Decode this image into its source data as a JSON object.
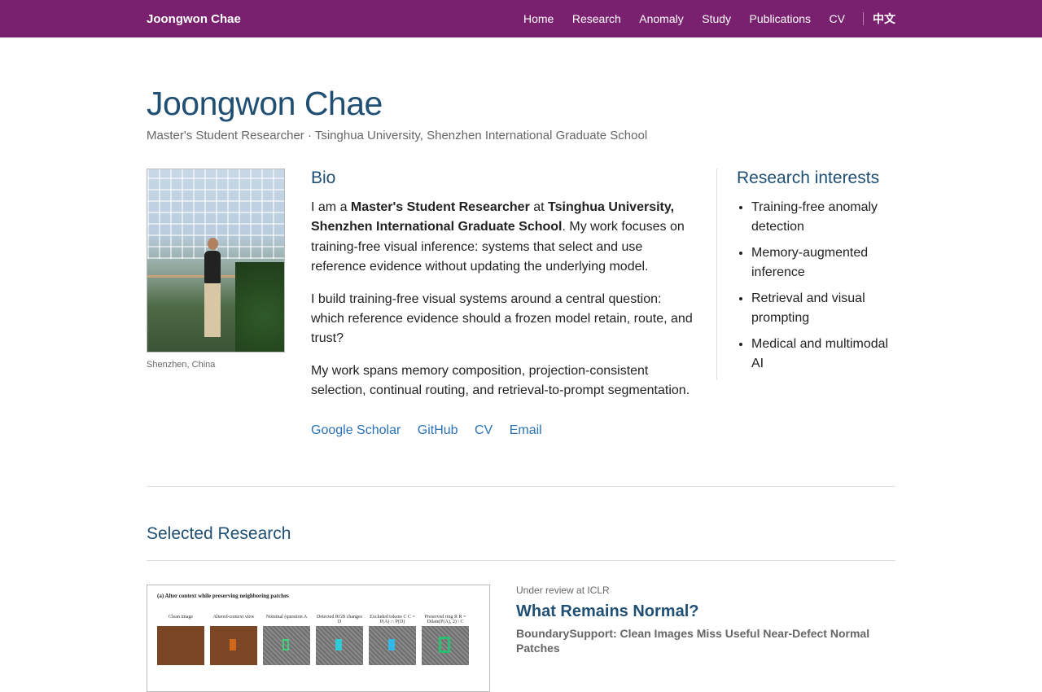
{
  "nav": {
    "brand": "Joongwon Chae",
    "items": [
      "Home",
      "Research",
      "Anomaly",
      "Study",
      "Publications",
      "CV"
    ],
    "lang": "中文"
  },
  "header": {
    "name": "Joongwon Chae",
    "subtitle": "Master's Student Researcher · Tsinghua University, Shenzhen International Graduate School"
  },
  "photo": {
    "caption": "Shenzhen, China"
  },
  "bio": {
    "heading": "Bio",
    "p1_a": "I am a ",
    "p1_role": "Master's Student Researcher",
    "p1_b": " at ",
    "p1_org": "Tsinghua University, Shenzhen International Graduate School",
    "p1_c": ". My work focuses on training-free visual inference: systems that select and use reference evidence without updating the underlying model.",
    "p2": "I build training-free visual systems around a central question: which reference evidence should a frozen model retain, route, and trust?",
    "p3": "My work spans memory composition, projection-consistent selection, continual routing, and retrieval-to-prompt segmentation.",
    "links": [
      "Google Scholar",
      "GitHub",
      "CV",
      "Email"
    ]
  },
  "interests": {
    "heading": "Research interests",
    "items": [
      "Training-free anomaly detection",
      "Memory-augmented inference",
      "Retrieval and visual prompting",
      "Medical and multimodal AI"
    ]
  },
  "research": {
    "heading": "Selected Research",
    "figure": {
      "title": "(a) Alter context while preserving neighboring patches",
      "panels": [
        "Clean image",
        "Altered-context view",
        "Nominal (question A",
        "Detected RGB changes D",
        "Excluded tokens C C = P(A) ∩ P(D)",
        "Preserved ring R R = Dilate(P(A), 2) \\ C"
      ]
    },
    "paper": {
      "venue": "Under review at ICLR",
      "title": "What Remains Normal?",
      "subtitle": "BoundarySupport: Clean Images Miss Useful Near-Defect Normal Patches"
    }
  },
  "colors": {
    "topbar": "#79216f",
    "heading": "#1f4f73",
    "link": "#2b72b5"
  }
}
